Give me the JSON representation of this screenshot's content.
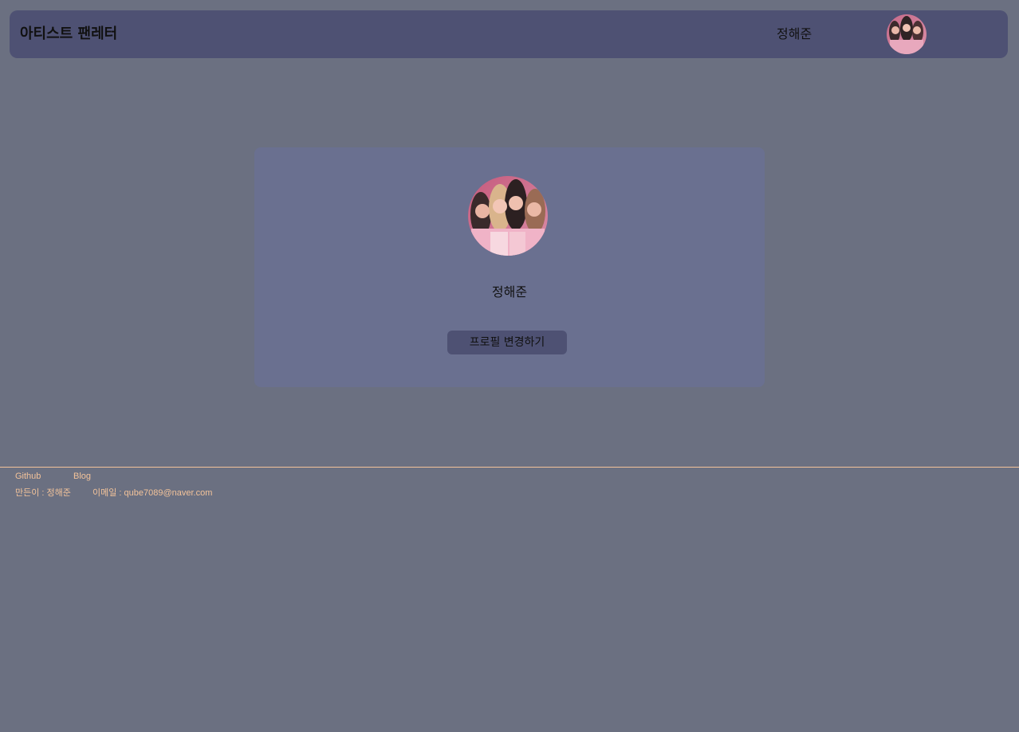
{
  "header": {
    "brand": "아티스트 팬레터",
    "user_name": "정해준",
    "avatar_icon": "profile-photo-icon"
  },
  "profile": {
    "name": "정해준",
    "edit_button_label": "프로필 변경하기",
    "avatar_icon": "profile-photo-icon"
  },
  "footer": {
    "links": [
      "Github",
      "Blog"
    ],
    "made_by": "만든이 : 정해준",
    "email": "이메일 : qube7089@naver.com"
  },
  "colors": {
    "background": "#6b7081",
    "header": "#4e5173",
    "card": "#6a7090",
    "button": "#4e5173",
    "footer_text": "#f3c39a"
  }
}
